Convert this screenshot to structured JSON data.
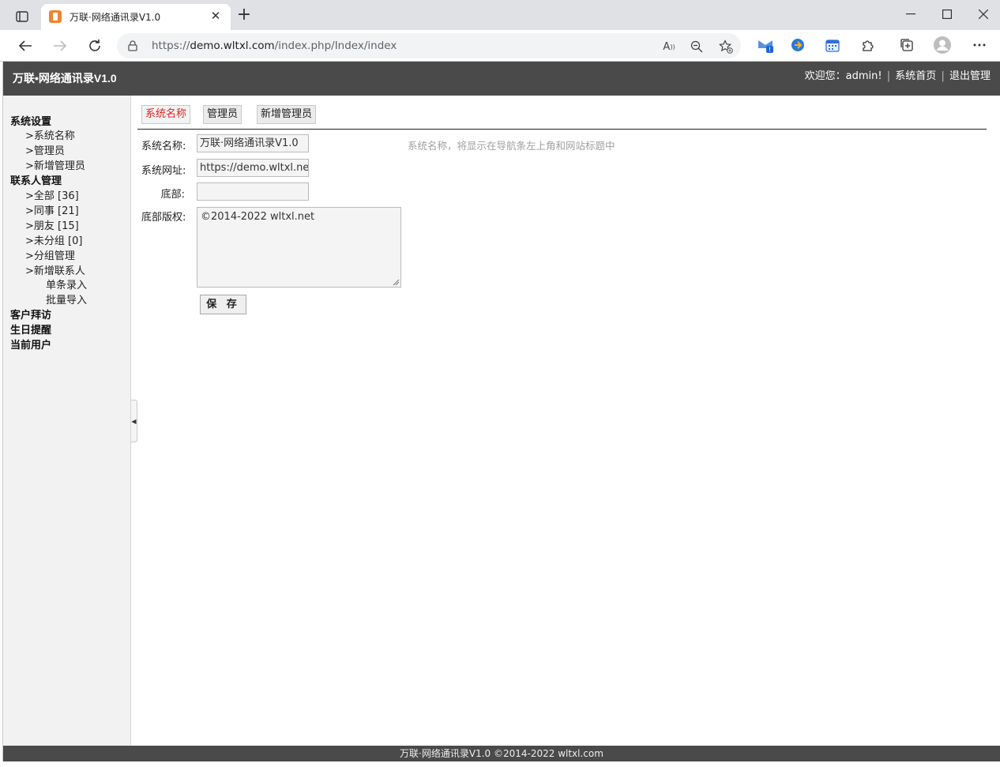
{
  "browser": {
    "tab_title": "万联·网络通讯录V1.0",
    "url_prefix": "https://",
    "url_host": "demo.wltxl.com",
    "url_path": "/index.php/Index/index",
    "icons": [
      "tab-actions-icon",
      "close-icon",
      "plus-icon",
      "minimize-icon",
      "maximize-icon",
      "window-close-icon",
      "back-icon",
      "forward-icon",
      "refresh-icon",
      "lock-icon",
      "read-aloud-icon",
      "zoom-out-icon",
      "favorite-add-icon",
      "extension-mail-icon",
      "extension-arrow-icon",
      "extension-calendar-icon",
      "extensions-puzzle-icon",
      "collections-icon",
      "profile-avatar-icon",
      "more-icon"
    ]
  },
  "header": {
    "site_title": "万联•网络通讯录V1.0",
    "welcome": "欢迎您：admin!",
    "sep1": "|",
    "home_link": "系统首页",
    "sep2": "|",
    "logout_link": "退出管理"
  },
  "sidebar": {
    "groups": [
      {
        "label": "系统设置"
      },
      {
        "label": "联系人管理"
      },
      {
        "label": "客户拜访"
      },
      {
        "label": "生日提醒"
      },
      {
        "label": "当前用户"
      }
    ],
    "system_items": [
      ">系统名称",
      ">管理员",
      ">新增管理员"
    ],
    "contact_items": [
      ">全部 [36]",
      ">同事 [21]",
      ">朋友 [15]",
      ">未分组 [0]",
      ">分组管理",
      ">新增联系人"
    ],
    "add_contact_sub": [
      "单条录入",
      "批量导入"
    ]
  },
  "main": {
    "tabs": [
      "系统名称",
      "管理员",
      "新增管理员"
    ],
    "form": {
      "name_label": "系统名称:",
      "name_value": "万联·网络通讯录V1.0",
      "name_hint": "系统名称，将显示在导航条左上角和网站标题中",
      "url_label": "系统网址:",
      "url_value": "https://demo.wltxl.net",
      "footer_label": "底部:",
      "footer_value": "",
      "copyright_label": "底部版权:",
      "copyright_value": "©2014-2022 wltxl.net",
      "save_label": "保 存"
    }
  },
  "footer": {
    "text": "万联·网络通讯录V1.0 ©2014-2022 wltxl.com"
  },
  "colors": {
    "header_bg": "#4a4a4a",
    "sidebar_bg": "#f2f2f2",
    "active_tab_text": "#dd2222",
    "hint_text": "#a0a0a0"
  }
}
